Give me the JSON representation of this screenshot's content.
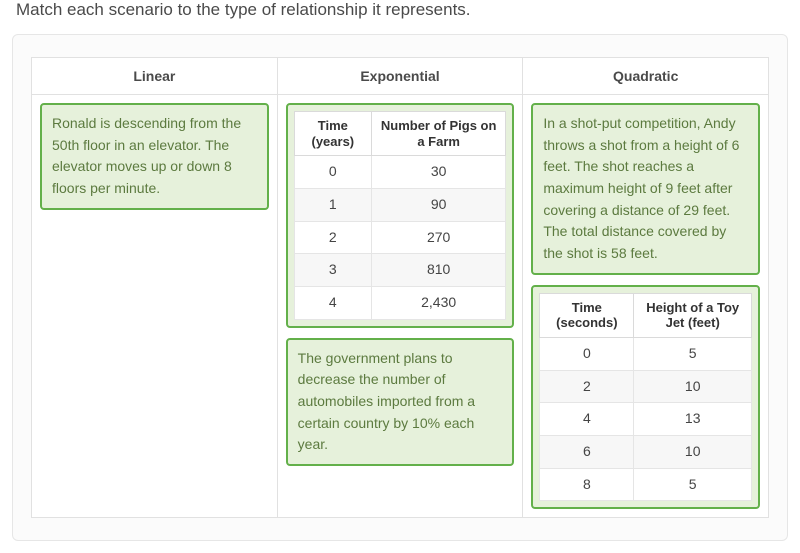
{
  "prompt": "Match each scenario to the type of relationship it represents.",
  "columns": {
    "linear": {
      "header": "Linear"
    },
    "exponential": {
      "header": "Exponential"
    },
    "quadratic": {
      "header": "Quadratic"
    }
  },
  "cards": {
    "linear_scenario": {
      "text": "Ronald is descending from the 50th floor in an elevator. The elevator moves up or down 8 floors per minute."
    },
    "exp_table": {
      "col1_header": "Time (years)",
      "col2_header": "Number of Pigs on a Farm",
      "rows": [
        {
          "c1": "0",
          "c2": "30"
        },
        {
          "c1": "1",
          "c2": "90"
        },
        {
          "c1": "2",
          "c2": "270"
        },
        {
          "c1": "3",
          "c2": "810"
        },
        {
          "c1": "4",
          "c2": "2,430"
        }
      ]
    },
    "exp_scenario": {
      "text": "The government plans to decrease the number of automobiles imported from a certain country by 10% each year."
    },
    "quad_scenario": {
      "text": "In a shot-put competition, Andy throws a shot from a height of 6 feet. The shot reaches a maximum height of 9 feet after covering a distance of 29 feet. The total distance covered by the shot is 58 feet."
    },
    "quad_table": {
      "col1_header": "Time (seconds)",
      "col2_header": "Height of a Toy Jet (feet)",
      "rows": [
        {
          "c1": "0",
          "c2": "5"
        },
        {
          "c1": "2",
          "c2": "10"
        },
        {
          "c1": "4",
          "c2": "13"
        },
        {
          "c1": "6",
          "c2": "10"
        },
        {
          "c1": "8",
          "c2": "5"
        }
      ]
    }
  },
  "chart_data": [
    {
      "type": "table",
      "title": "Pigs on a Farm over Time",
      "columns": [
        "Time (years)",
        "Number of Pigs on a Farm"
      ],
      "rows": [
        [
          0,
          30
        ],
        [
          1,
          90
        ],
        [
          2,
          270
        ],
        [
          3,
          810
        ],
        [
          4,
          2430
        ]
      ]
    },
    {
      "type": "table",
      "title": "Toy Jet Height over Time",
      "columns": [
        "Time (seconds)",
        "Height of a Toy Jet (feet)"
      ],
      "rows": [
        [
          0,
          5
        ],
        [
          2,
          10
        ],
        [
          4,
          13
        ],
        [
          6,
          10
        ],
        [
          8,
          5
        ]
      ]
    }
  ]
}
